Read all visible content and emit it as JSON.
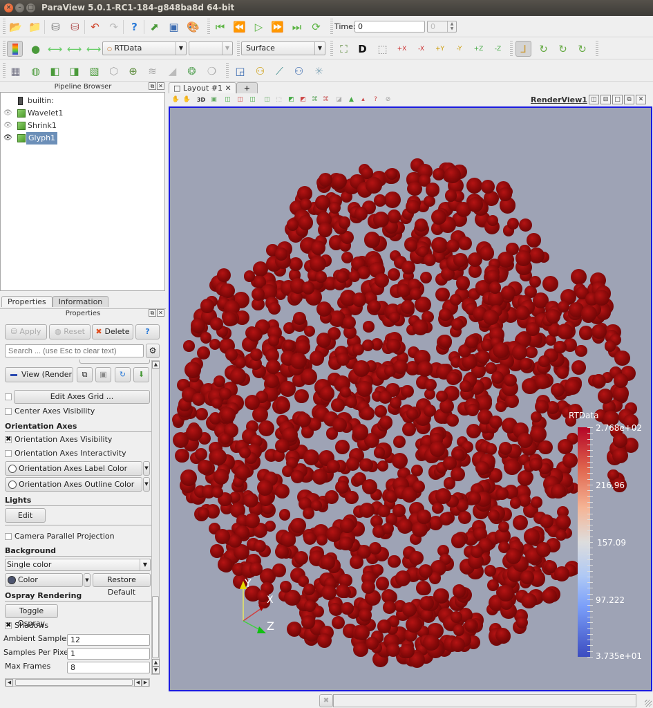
{
  "window": {
    "title": "ParaView 5.0.1-RC1-184-g848ba8d 64-bit",
    "buttons": [
      "close",
      "minimize",
      "maximize"
    ]
  },
  "toolbar1": {
    "icons": [
      "open-file-icon",
      "load-state-icon",
      "connect-icon",
      "disconnect-icon",
      "undo-icon",
      "redo-icon",
      "help-icon",
      "save-data-icon",
      "screenshot-icon",
      "color-palette-icon"
    ],
    "vcr": [
      "first-frame-icon",
      "previous-frame-icon",
      "play-icon",
      "next-frame-icon",
      "last-frame-icon",
      "loop-icon"
    ],
    "time_label": "Time:",
    "time_value": "0",
    "timestep_value": "0"
  },
  "toolbar2": {
    "icons": [
      "color-legend-icon",
      "edit-color-map-icon",
      "rescale-range-icon",
      "rescale-custom-range-icon",
      "rescale-visible-range-icon"
    ],
    "color_by": "RTData",
    "component": "",
    "representation": "Surface",
    "camera_icons": [
      "reset-camera-icon",
      "reset-camera-closest-icon",
      "zoom-to-box-icon",
      "view-plus-x-icon",
      "view-minus-x-icon",
      "view-plus-y-icon",
      "view-minus-y-icon",
      "view-plus-z-icon",
      "view-minus-z-icon"
    ],
    "orientation_icons": [
      "show-orientation-axes-icon",
      "rotate-90-cw-icon",
      "rotate-90-ccw-icon",
      "rotate-camera-icon"
    ]
  },
  "toolbar3": {
    "icons": [
      "calculator-icon",
      "contour-icon",
      "clip-icon",
      "slice-icon",
      "threshold-icon",
      "extract-subset-icon",
      "glyph-icon",
      "stream-tracer-icon",
      "warp-by-vector-icon",
      "group-datasets-icon",
      "extract-level-icon",
      "select-icon",
      "probe-icon",
      "plot-over-line-icon",
      "plot-selection-icon",
      "fft-icon"
    ]
  },
  "pipeline": {
    "title": "Pipeline Browser",
    "items": [
      {
        "label": "builtin:",
        "type": "server"
      },
      {
        "label": "Wavelet1",
        "visible": false
      },
      {
        "label": "Shrink1",
        "visible": false
      },
      {
        "label": "Glyph1",
        "visible": true,
        "selected": true
      }
    ]
  },
  "properties": {
    "tabs": [
      "Properties",
      "Information"
    ],
    "panel_title": "Properties",
    "apply": "Apply",
    "reset": "Reset",
    "delete": "Delete",
    "help": "?",
    "search_placeholder": "Search ... (use Esc to clear text)",
    "view_label": "View (Render",
    "edit_axes_grid": "Edit Axes Grid ...",
    "center_axes_visibility": "Center Axes Visibility",
    "section_orientation": "Orientation Axes",
    "orientation_visibility": "Orientation Axes Visibility",
    "orientation_interactivity": "Orientation Axes Interactivity",
    "orientation_label_color": "Orientation Axes Label Color",
    "orientation_outline_color": "Orientation Axes Outline Color",
    "section_lights": "Lights",
    "lights_edit": "Edit",
    "camera_parallel": "Camera Parallel Projection",
    "section_background": "Background",
    "background_mode": "Single color",
    "color_button": "Color",
    "background_color": "#4d5570",
    "restore_default": "Restore Default",
    "section_ospray": "Ospray Rendering",
    "toggle_ospray": "Toggle Ospray",
    "shadows": "Shadows",
    "ambient_samples_label": "Ambient Samples",
    "ambient_samples": "12",
    "samples_per_pixel_label": "Samples Per Pixel",
    "samples_per_pixel": "1",
    "max_frames_label": "Max Frames",
    "max_frames": "8",
    "checks": {
      "center_axes_visibility": false,
      "orientation_visibility": true,
      "orientation_interactivity": false,
      "camera_parallel": false,
      "shadows": true
    }
  },
  "layout": {
    "tab_label": "Layout #1",
    "add_tab": "+",
    "view_name": "RenderView1",
    "view_3d_label": "3D"
  },
  "render": {
    "background": "#9ea3b5",
    "glyph_color": "#8a0a0a",
    "axes": {
      "x": "X",
      "y": "Y",
      "z": "Z"
    },
    "legend": {
      "title": "RTData",
      "labels": [
        "2.768e+02",
        "216.96",
        "157.09",
        "97.222",
        "3.735e+01"
      ],
      "range": [
        37.35,
        276.8
      ]
    }
  }
}
